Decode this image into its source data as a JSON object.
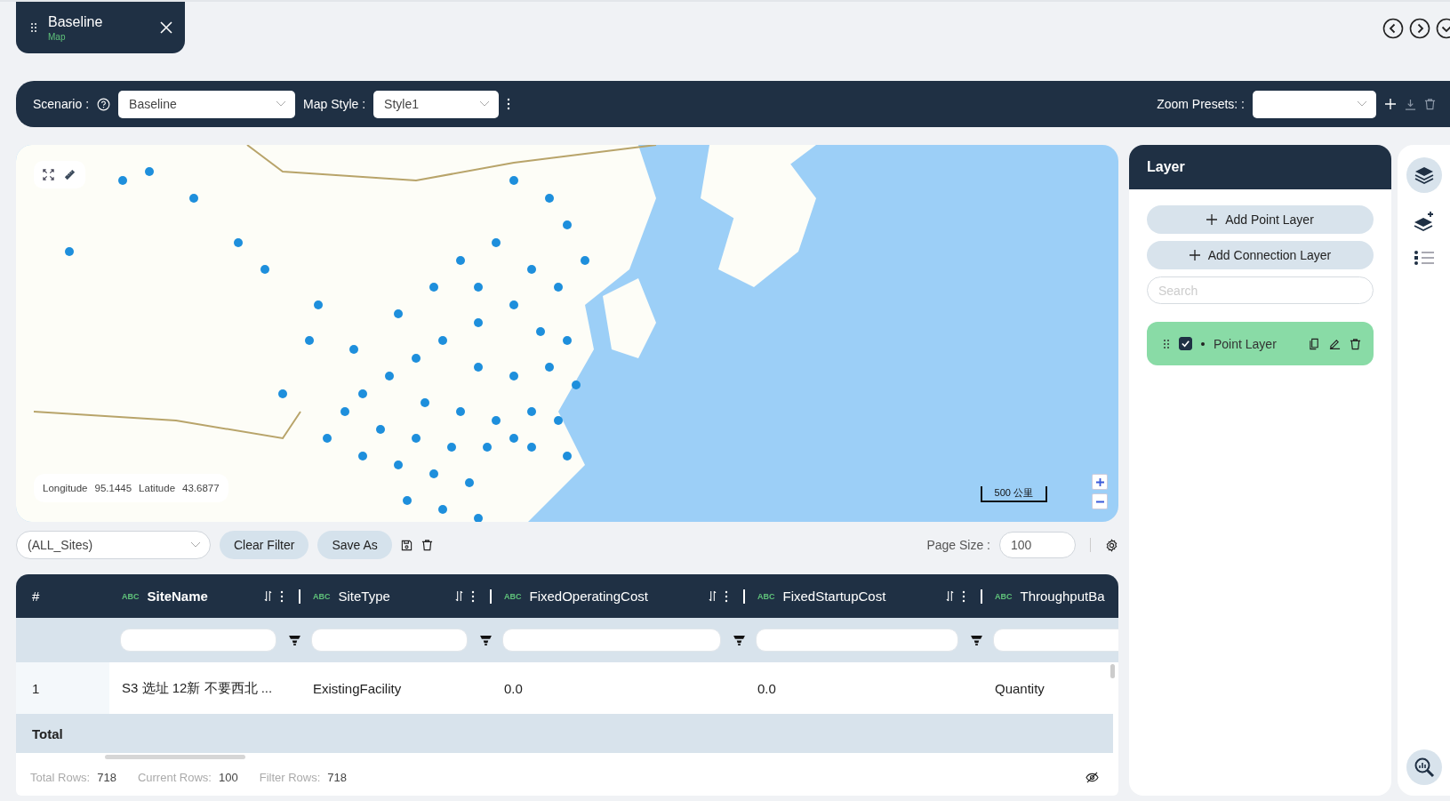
{
  "tab": {
    "title": "Baseline",
    "subtitle": "Map"
  },
  "toolbar": {
    "scenario_label": "Scenario :",
    "scenario_value": "Baseline",
    "map_style_label": "Map Style :",
    "map_style_value": "Style1",
    "zoom_presets_label": "Zoom Presets: :"
  },
  "map": {
    "longitude_label": "Longitude",
    "longitude": "95.1445",
    "latitude_label": "Latitude",
    "latitude": "43.6877",
    "scale": "500 公里"
  },
  "layer_panel": {
    "title": "Layer",
    "buttons": [
      "Add Point Layer",
      "Add Connection Layer"
    ],
    "search_placeholder": "Search",
    "layers": [
      {
        "name": "Point Layer",
        "checked": true
      }
    ]
  },
  "table_toolbar": {
    "view": "(ALL_Sites)",
    "buttons": [
      "Clear Filter",
      "Save As"
    ],
    "page_size_label": "Page Size :",
    "page_size": "100"
  },
  "table": {
    "index_heading": "#",
    "columns": [
      {
        "type": "ABC",
        "name": "SiteName",
        "selected": true
      },
      {
        "type": "ABC",
        "name": "SiteType",
        "selected": false
      },
      {
        "type": "ABC",
        "name": "FixedOperatingCost",
        "selected": false
      },
      {
        "type": "ABC",
        "name": "FixedStartupCost",
        "selected": false
      },
      {
        "type": "ABC",
        "name": "ThroughputBa",
        "selected": false
      }
    ],
    "rows": [
      {
        "index": "1",
        "cells": [
          "S3 选址 12新 不要西北 ...",
          "ExistingFacility",
          "0.0",
          "0.0",
          "Quantity"
        ]
      }
    ],
    "total_label": "Total",
    "stats": [
      {
        "label": "Total Rows:",
        "value": "718"
      },
      {
        "label": "Current Rows:",
        "value": "100"
      },
      {
        "label": "Filter Rows:",
        "value": "718"
      }
    ]
  }
}
